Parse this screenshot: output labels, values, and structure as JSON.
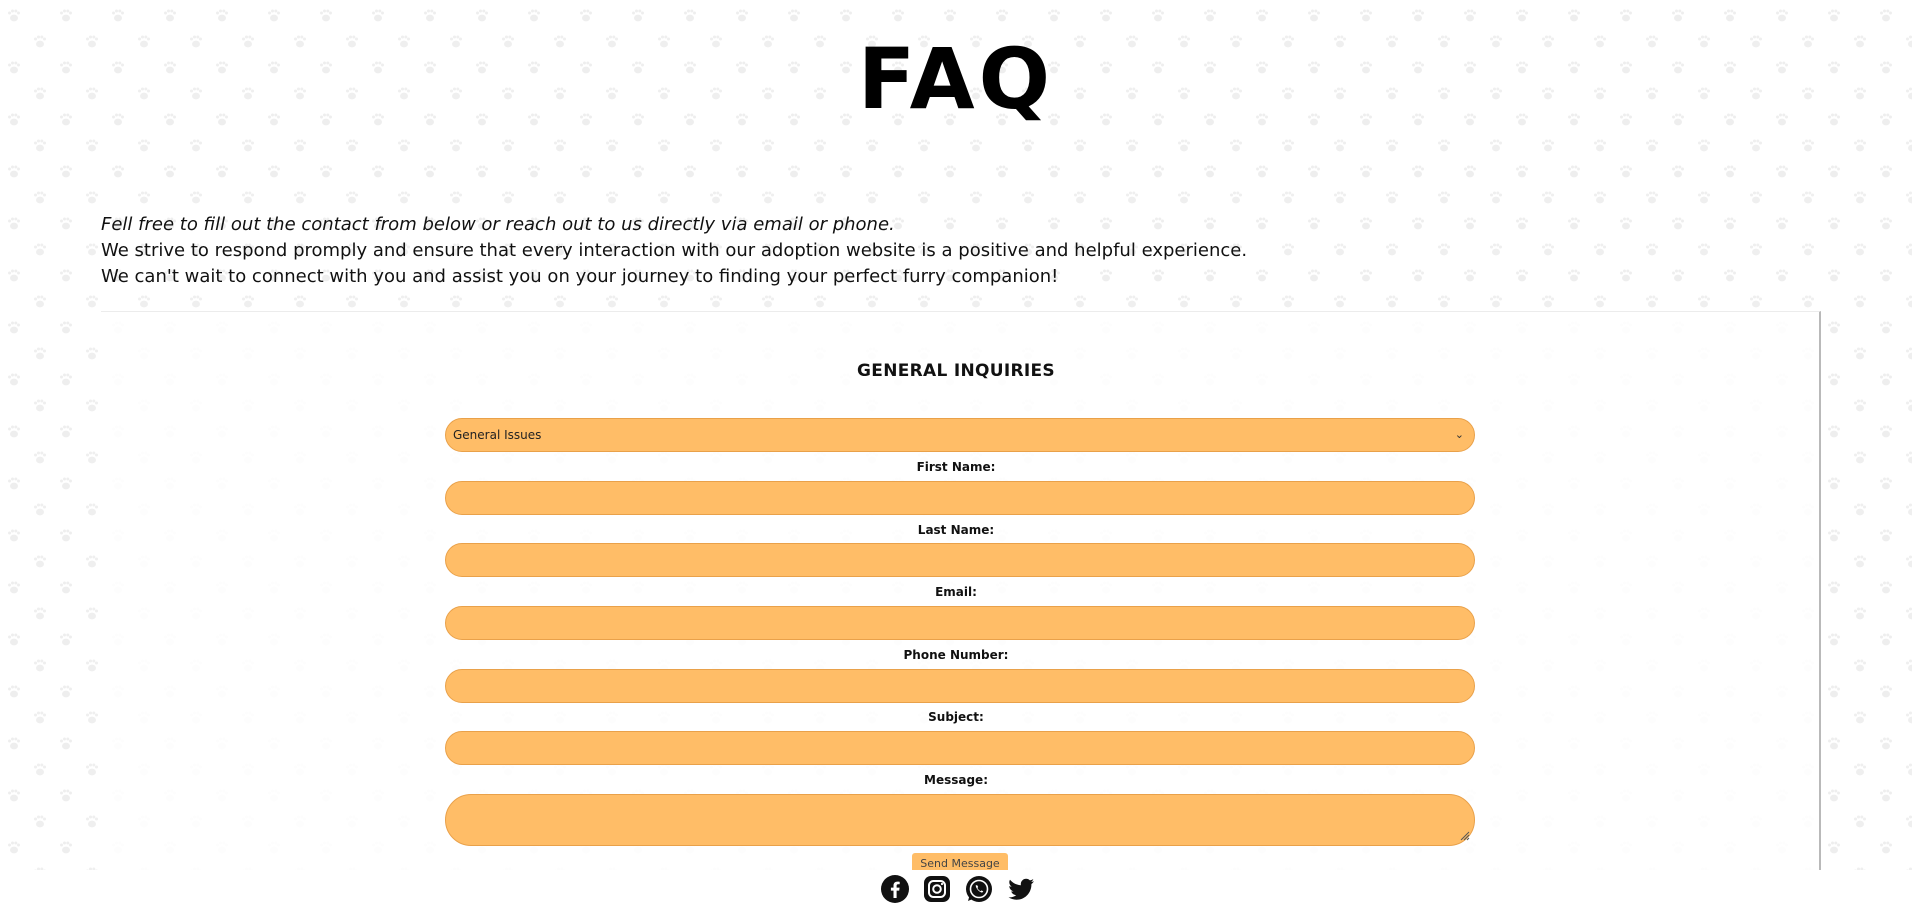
{
  "page": {
    "title": "FAQ",
    "intro": {
      "line1": "Fell free to fill out the contact from below or reach out to us directly via email or phone.",
      "line2": "We strive to respond promply and ensure that every interaction with our adoption website is a positive and helpful experience.",
      "line3": "We can't wait to connect with you and assist you on your journey to finding your perfect furry companion!"
    }
  },
  "form": {
    "title": "GENERAL INQUIRIES",
    "category_selected": "General Issues",
    "labels": {
      "first_name": "First Name:",
      "last_name": "Last Name:",
      "email": "Email:",
      "phone": "Phone Number:",
      "subject": "Subject:",
      "message": "Message:"
    },
    "values": {
      "first_name": "",
      "last_name": "",
      "email": "",
      "phone": "",
      "subject": "",
      "message": ""
    },
    "send_label": "Send Message"
  },
  "footer": {
    "social_icons": [
      "facebook-icon",
      "instagram-icon",
      "whatsapp-icon",
      "twitter-icon"
    ]
  },
  "colors": {
    "field_fill": "#ffbd67",
    "field_border": "#e9a14a",
    "text": "#111111"
  }
}
